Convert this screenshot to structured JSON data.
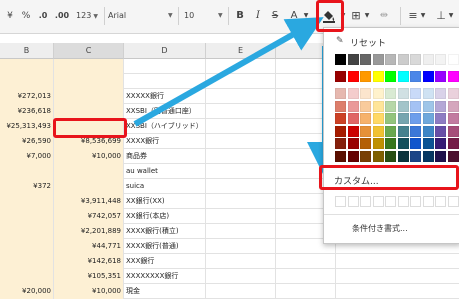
{
  "toolbar": {
    "currency": "¥",
    "percent": "%",
    "decrease_decimal": ".0",
    "increase_decimal": ".00",
    "number_format": "123",
    "font_name": "Arial",
    "font_size": "10",
    "bold": "B",
    "italic": "I",
    "strike": "S",
    "text_color": "A"
  },
  "columns": [
    "B",
    "C",
    "D",
    "E"
  ],
  "rows": [
    {
      "b": "",
      "c": "",
      "d": ""
    },
    {
      "b": "",
      "c": "",
      "d": ""
    },
    {
      "b": "¥272,013",
      "c": "",
      "d": "XXXXX銀行"
    },
    {
      "b": "¥236,618",
      "c": "",
      "d": "XXSBI（円普通口座）"
    },
    {
      "b": "¥25,313,493",
      "c": "",
      "d": "XXSBI（ハイブリッド）"
    },
    {
      "b": "¥26,590",
      "c": "¥8,536,699",
      "d": "XXXX銀行"
    },
    {
      "b": "¥7,000",
      "c": "¥10,000",
      "d": "商品券"
    },
    {
      "b": "",
      "c": "",
      "d": "au wallet"
    },
    {
      "b": "¥372",
      "c": "",
      "d": "suica"
    },
    {
      "b": "",
      "c": "¥3,911,448",
      "d": "XX銀行(XX)"
    },
    {
      "b": "",
      "c": "¥742,057",
      "d": "XX銀行(本店)"
    },
    {
      "b": "",
      "c": "¥2,201,889",
      "d": "XXXX銀行(積立)"
    },
    {
      "b": "",
      "c": "¥44,771",
      "d": "XXXX銀行(普通)"
    },
    {
      "b": "",
      "c": "¥142,618",
      "d": "XXX銀行"
    },
    {
      "b": "",
      "c": "¥105,351",
      "d": "XXXXXXXX銀行"
    },
    {
      "b": "¥20,000",
      "c": "¥10,000",
      "d": "現金"
    }
  ],
  "menu": {
    "reset": "リセット",
    "custom": "カスタム...",
    "conditional": "条件付き書式..."
  },
  "colors": {
    "highlight": "#e8141b",
    "arrow": "#2aa8e0",
    "cell_fill": "#fdf0d4",
    "grays": [
      "#000000",
      "#434343",
      "#666666",
      "#999999",
      "#b7b7b7",
      "#cccccc",
      "#d9d9d9",
      "#efefef",
      "#f3f3f3",
      "#ffffff"
    ],
    "brights": [
      "#980000",
      "#ff0000",
      "#ff9900",
      "#ffff00",
      "#00ff00",
      "#00ffff",
      "#4a86e8",
      "#0000ff",
      "#9900ff",
      "#ff00ff"
    ],
    "shades": [
      [
        "#e6b8af",
        "#f4cccc",
        "#fce5cd",
        "#fff2cc",
        "#d9ead3",
        "#d0e0e3",
        "#c9daf8",
        "#cfe2f3",
        "#d9d2e9",
        "#ead1dc"
      ],
      [
        "#dd7e6b",
        "#ea9999",
        "#f9cb9c",
        "#ffe599",
        "#b6d7a8",
        "#a2c4c9",
        "#a4c2f4",
        "#9fc5e8",
        "#b4a7d6",
        "#d5a6bd"
      ],
      [
        "#cc4125",
        "#e06666",
        "#f6b26b",
        "#ffd966",
        "#93c47d",
        "#76a5af",
        "#6d9eeb",
        "#6fa8dc",
        "#8e7cc3",
        "#c27ba0"
      ],
      [
        "#a61c00",
        "#cc0000",
        "#e69138",
        "#f1c232",
        "#6aa84f",
        "#45818e",
        "#3c78d8",
        "#3d85c6",
        "#674ea7",
        "#a64d79"
      ],
      [
        "#85200c",
        "#990000",
        "#b45f06",
        "#bf9000",
        "#38761d",
        "#134f5c",
        "#1155cc",
        "#0b5394",
        "#351c75",
        "#741b47"
      ],
      [
        "#5b0f00",
        "#660000",
        "#783f04",
        "#7f6000",
        "#274e13",
        "#0c343d",
        "#1c4587",
        "#073763",
        "#20124d",
        "#4c1130"
      ]
    ]
  }
}
